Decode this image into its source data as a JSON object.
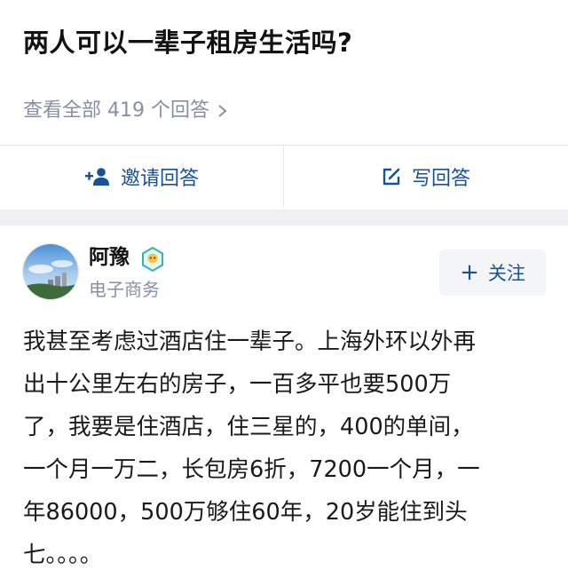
{
  "question": {
    "title": "两人可以一辈子租房生活吗?",
    "view_all": "查看全部 419 个回答"
  },
  "actions": {
    "invite_label": "邀请回答",
    "invite_icon": "add-person-icon",
    "write_label": "写回答",
    "write_icon": "pencil-square-icon"
  },
  "author": {
    "name": "阿豫",
    "bio": "电子商务",
    "badge_icon": "verified-badge-icon",
    "follow_label": "关注"
  },
  "answer": {
    "lines": [
      "我甚至考虑过酒店住一辈子。上海外环以外再",
      "出十公里左右的房子，一百多平也要500万",
      "了，我要是住酒店，住三星的，400的单间，",
      "一个月一万二，长包房6折，7200一个月，一",
      "年86000，500万够住60年，20岁能住到头",
      "七。。。。"
    ]
  },
  "colors": {
    "link_blue": "#175199",
    "muted_gray": "#8590a6",
    "band_gray": "#f1f1f3",
    "badge_teal": "#2fb8a6"
  }
}
